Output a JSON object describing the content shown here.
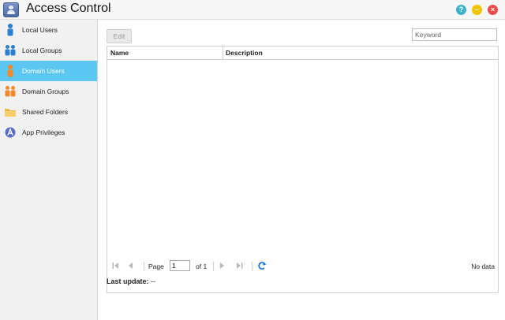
{
  "window": {
    "title": "Access Control",
    "buttons": {
      "help": "?",
      "minimize": "–",
      "close": "×"
    }
  },
  "sidebar": {
    "items": [
      {
        "label": "Local Users",
        "icon": "local-users-icon",
        "active": false
      },
      {
        "label": "Local Groups",
        "icon": "local-groups-icon",
        "active": false
      },
      {
        "label": "Domain Users",
        "icon": "domain-users-icon",
        "active": true
      },
      {
        "label": "Domain Groups",
        "icon": "domain-groups-icon",
        "active": false
      },
      {
        "label": "Shared Folders",
        "icon": "folder-icon",
        "active": false
      },
      {
        "label": "App Privileges",
        "icon": "app-privileges-icon",
        "active": false
      }
    ]
  },
  "toolbar": {
    "edit_label": "Edit",
    "search_placeholder": "Keyword"
  },
  "table": {
    "columns": [
      "Name",
      "Description"
    ],
    "rows": []
  },
  "pager": {
    "page_label": "Page",
    "page_value": "1",
    "of_label": "of 1",
    "status": "No data"
  },
  "footer": {
    "last_update_label": "Last update:",
    "last_update_value": "--"
  },
  "colors": {
    "active_item": "#5cc7f1",
    "help": "#3db3c9",
    "minimize": "#f3c300",
    "close": "#ef4b4b",
    "user_blue": "#2a7fd0",
    "user_orange": "#f08a2c"
  }
}
